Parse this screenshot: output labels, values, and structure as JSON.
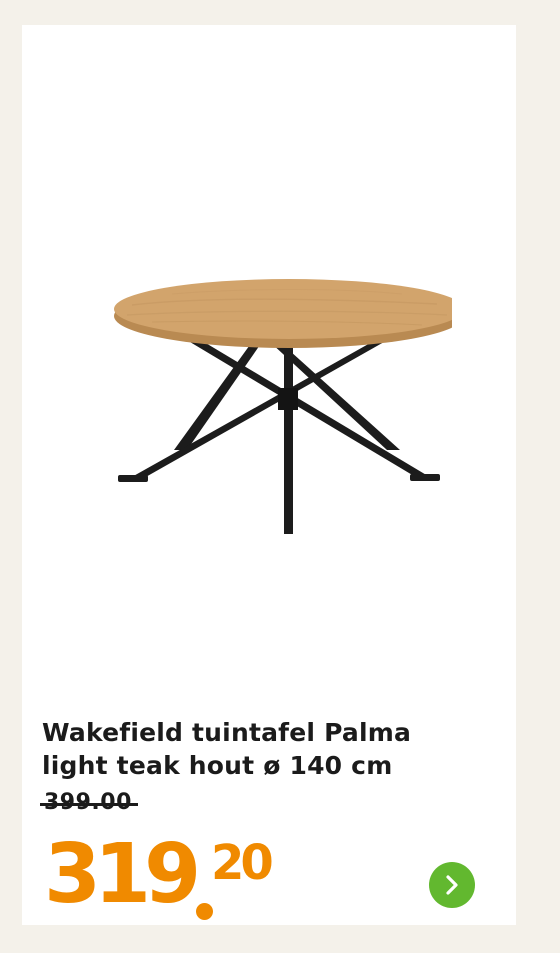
{
  "product": {
    "title_line1": "Wakefield tuintafel Palma",
    "title_line2": "light teak hout ø 140 cm",
    "old_price": "399.00",
    "price_main": "319",
    "price_cents": "20",
    "image_icon": "round-garden-table-image",
    "next_icon": "chevron-right-icon"
  },
  "colors": {
    "background": "#f4f1ea",
    "card": "#ffffff",
    "price": "#f08a00",
    "next_button": "#62b82f",
    "text": "#1b1b1b",
    "table_top": "#d2a46c",
    "table_legs": "#1c1c1c"
  }
}
